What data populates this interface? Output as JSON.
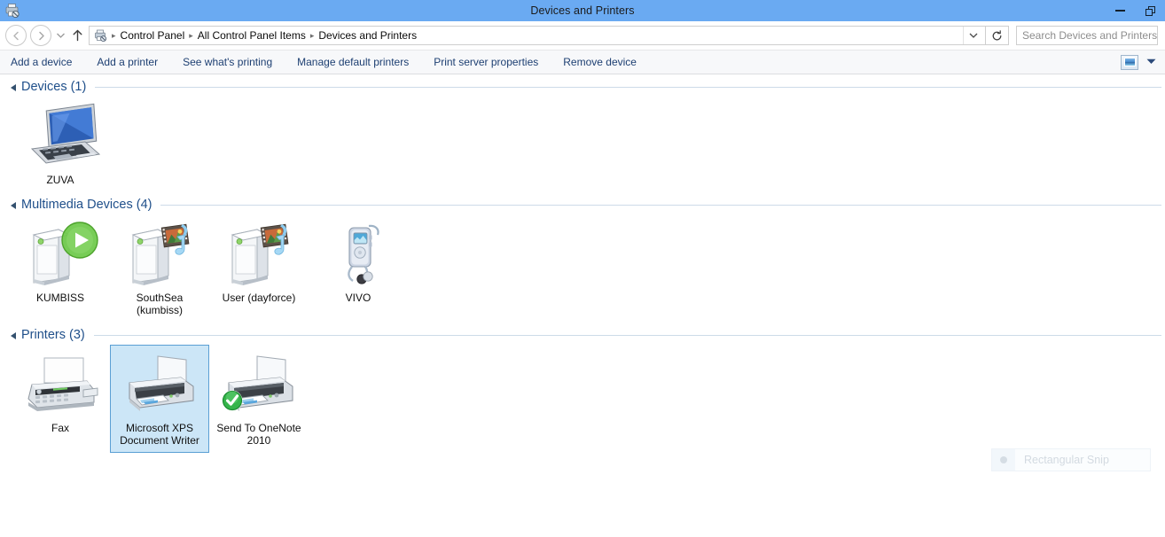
{
  "window": {
    "title": "Devices and Printers",
    "icon": "devices-and-printers-icon",
    "minimize_label": "Minimize",
    "maximize_label": "Maximize"
  },
  "navigation": {
    "back_label": "Back",
    "forward_label": "Forward",
    "recent_label": "Recent locations",
    "up_label": "Up one level",
    "refresh_label": "Refresh",
    "address_dropdown_label": "Previous locations"
  },
  "breadcrumb": {
    "icon": "printer-icon",
    "items": [
      "Control Panel",
      "All Control Panel Items",
      "Devices and Printers"
    ],
    "separator": "▸"
  },
  "search": {
    "placeholder": "Search Devices and Printers",
    "value": ""
  },
  "toolbar": {
    "items": [
      "Add a device",
      "Add a printer",
      "See what's printing",
      "Manage default printers",
      "Print server properties",
      "Remove device"
    ],
    "preview_pane_label": "Preview pane",
    "help_dropdown_label": "Help options"
  },
  "groups": [
    {
      "title": "Devices (1)",
      "name": "devices",
      "expanded": true,
      "items": [
        {
          "label": "ZUVA",
          "icon": "laptop-icon",
          "selected": false,
          "badge": "none"
        }
      ]
    },
    {
      "title": "Multimedia Devices (4)",
      "name": "multimedia-devices",
      "expanded": true,
      "items": [
        {
          "label": "KUMBISS",
          "icon": "media-server-icon",
          "selected": false,
          "badge": "play-badge"
        },
        {
          "label": "SouthSea (kumbiss)",
          "icon": "media-server-icon",
          "selected": false,
          "badge": "media-badge"
        },
        {
          "label": "User (dayforce)",
          "icon": "media-server-icon",
          "selected": false,
          "badge": "media-badge"
        },
        {
          "label": "VIVO",
          "icon": "portable-media-player-icon",
          "selected": false,
          "badge": "none"
        }
      ]
    },
    {
      "title": "Printers (3)",
      "name": "printers",
      "expanded": true,
      "items": [
        {
          "label": "Fax",
          "icon": "fax-icon",
          "selected": false,
          "badge": "none"
        },
        {
          "label": "Microsoft XPS Document Writer",
          "icon": "printer-icon",
          "selected": true,
          "badge": "none"
        },
        {
          "label": "Send To OneNote 2010",
          "icon": "printer-icon",
          "selected": false,
          "badge": "default-check-badge"
        }
      ]
    }
  ],
  "snip_overlay": {
    "label": "Rectangular Snip",
    "icon": "snip-mode-icon"
  },
  "colors": {
    "titlebar": "#6aaaf2",
    "group_title": "#1f4f8a",
    "command_link": "#1d3f72",
    "selection_fill": "#cce6f7",
    "selection_border": "#5a9fd4",
    "default_badge": "#36b34a"
  }
}
